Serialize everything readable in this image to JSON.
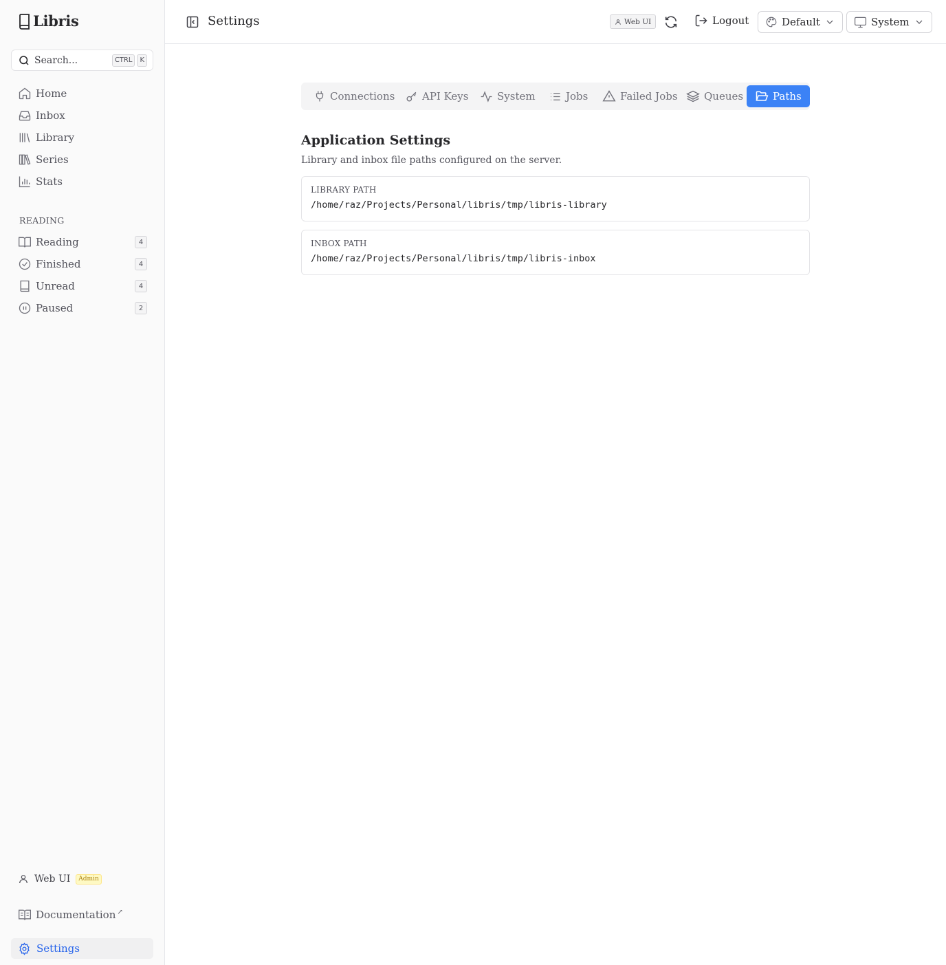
{
  "app": {
    "name": "Libris"
  },
  "search": {
    "placeholder": "Search...",
    "shortcut_mod": "CTRL",
    "shortcut_key": "K"
  },
  "sidebar": {
    "nav": [
      {
        "label": "Home",
        "icon": "home-icon"
      },
      {
        "label": "Inbox",
        "icon": "inbox-icon"
      },
      {
        "label": "Library",
        "icon": "library-icon"
      },
      {
        "label": "Series",
        "icon": "series-icon"
      },
      {
        "label": "Stats",
        "icon": "stats-icon"
      }
    ],
    "section_label": "READING",
    "reading": [
      {
        "label": "Reading",
        "count": "4",
        "icon": "book-open-icon"
      },
      {
        "label": "Finished",
        "count": "4",
        "icon": "check-circle-icon"
      },
      {
        "label": "Unread",
        "count": "4",
        "icon": "book-icon"
      },
      {
        "label": "Paused",
        "count": "2",
        "icon": "pause-circle-icon"
      }
    ],
    "user": {
      "name": "Web UI",
      "role": "Admin"
    },
    "documentation": "Documentation",
    "documentation_mark": "↗",
    "settings": "Settings"
  },
  "header": {
    "title": "Settings",
    "user_chip": "Web UI",
    "logout": "Logout",
    "theme": "Default",
    "mode": "System"
  },
  "tabs": [
    {
      "label": "Connections",
      "icon": "plug-icon"
    },
    {
      "label": "API Keys",
      "icon": "key-icon"
    },
    {
      "label": "System",
      "icon": "activity-icon"
    },
    {
      "label": "Jobs",
      "icon": "list-icon"
    },
    {
      "label": "Failed Jobs",
      "icon": "alert-triangle-icon"
    },
    {
      "label": "Queues",
      "icon": "layers-icon"
    },
    {
      "label": "Paths",
      "icon": "folder-open-icon",
      "active": true
    }
  ],
  "main": {
    "heading": "Application Settings",
    "description": "Library and inbox file paths configured on the server.",
    "paths": [
      {
        "label": "LIBRARY PATH",
        "value": "/home/raz/Projects/Personal/libris/tmp/libris-library"
      },
      {
        "label": "INBOX PATH",
        "value": "/home/raz/Projects/Personal/libris/tmp/libris-inbox"
      }
    ]
  },
  "colors": {
    "accent": "#3b82f6",
    "accent_text": "#2563eb",
    "admin_badge": "#fef9c3"
  }
}
